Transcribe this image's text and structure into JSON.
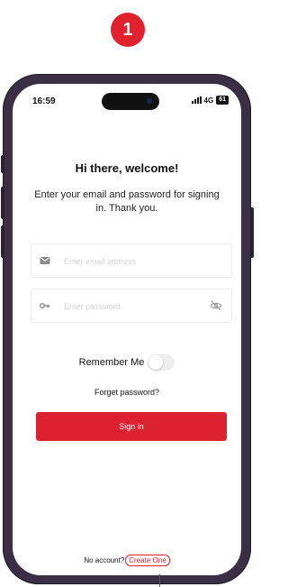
{
  "step_number": "1",
  "status_bar": {
    "time": "16:59",
    "network": "4G",
    "battery": "61"
  },
  "login": {
    "title": "Hi there, welcome!",
    "subtitle": "Enter your email and password for signing in. Thank you.",
    "email_placeholder": "Enter email address",
    "email_icon": "mail-icon",
    "password_placeholder": "Enter password",
    "password_icon": "key-icon",
    "visibility_icon": "eye-off-icon",
    "remember_label": "Remember Me",
    "remember_on": false,
    "forgot_label": "Forget password?",
    "signin_label": "Sign in",
    "no_account_label": "No account?",
    "create_label": "Create One"
  },
  "colors": {
    "accent": "#dc2231",
    "frame": "#3a2f45"
  }
}
